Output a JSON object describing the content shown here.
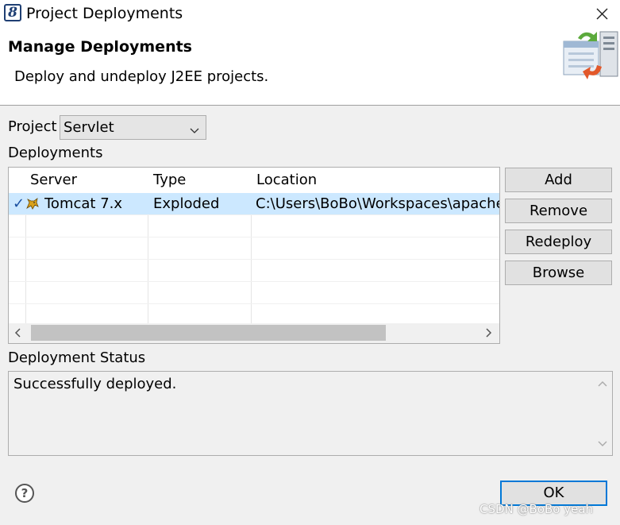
{
  "window": {
    "title": "Project Deployments",
    "app_icon_glyph": "8",
    "close_icon": "close-icon"
  },
  "banner": {
    "heading": "Manage Deployments",
    "description": "Deploy and undeploy J2EE projects.",
    "graphic_icon": "deployment-server-icon"
  },
  "project": {
    "label": "Project",
    "selected": "Servlet"
  },
  "deployments": {
    "label": "Deployments",
    "columns": [
      "Server",
      "Type",
      "Location"
    ],
    "rows": [
      {
        "checked": true,
        "check_glyph": "✓",
        "server": "Tomcat  7.x",
        "type": "Exploded",
        "location": "C:\\Users\\BoBo\\Workspaces\\apache-"
      }
    ],
    "scroll_left_glyph": "<",
    "scroll_right_glyph": ">"
  },
  "buttons": {
    "add": "Add",
    "remove": "Remove",
    "redeploy": "Redeploy",
    "browse": "Browse"
  },
  "status": {
    "label": "Deployment Status",
    "text": "Successfully deployed."
  },
  "footer": {
    "help_glyph": "?",
    "ok": "OK",
    "watermark": "CSDN @BoBo yeah"
  },
  "colors": {
    "selection": "#cce8ff",
    "focus_border": "#0078d7",
    "button_face": "#e1e1e1"
  }
}
